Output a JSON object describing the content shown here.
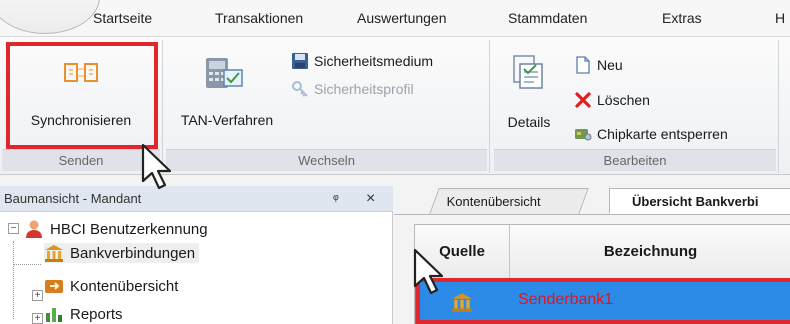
{
  "menu": {
    "tabs": [
      "Startseite",
      "Transaktionen",
      "Auswertungen",
      "Stammdaten",
      "Extras",
      "H"
    ]
  },
  "ribbon": {
    "groups": {
      "senden": {
        "label": "Senden",
        "synchronize_label": "Synchronisieren"
      },
      "wechseln": {
        "label": "Wechseln",
        "tan_label": "TAN-Verfahren",
        "sicherheitsmedium_label": "Sicherheitsmedium",
        "sicherheitsprofil_label": "Sicherheitsprofil"
      },
      "bearbeiten": {
        "label": "Bearbeiten",
        "details_label": "Details",
        "neu_label": "Neu",
        "loeschen_label": "Löschen",
        "chipkarte_label": "Chipkarte entsperren"
      }
    }
  },
  "tree_pane": {
    "title": "Baumansicht - Mandant",
    "pin_glyph": "ᵠ",
    "close_glyph": "×",
    "items": [
      {
        "label": "HBCI Benutzerkennung",
        "expander": "−"
      },
      {
        "label": "Bankverbindungen",
        "expander": ""
      },
      {
        "label": "Kontenübersicht",
        "expander": "+"
      },
      {
        "label": "Reports",
        "expander": "+"
      }
    ]
  },
  "right_pane": {
    "tabs": [
      "Kontenübersicht",
      "Übersicht Bankverbi"
    ],
    "grid": {
      "columns": [
        "Quelle",
        "Bezeichnung"
      ],
      "rows": [
        {
          "bezeichnung": "Senderbank1"
        }
      ]
    }
  },
  "colors": {
    "highlight": "#e0272d",
    "selection": "#2b8be6",
    "red_text": "#e3141c"
  }
}
